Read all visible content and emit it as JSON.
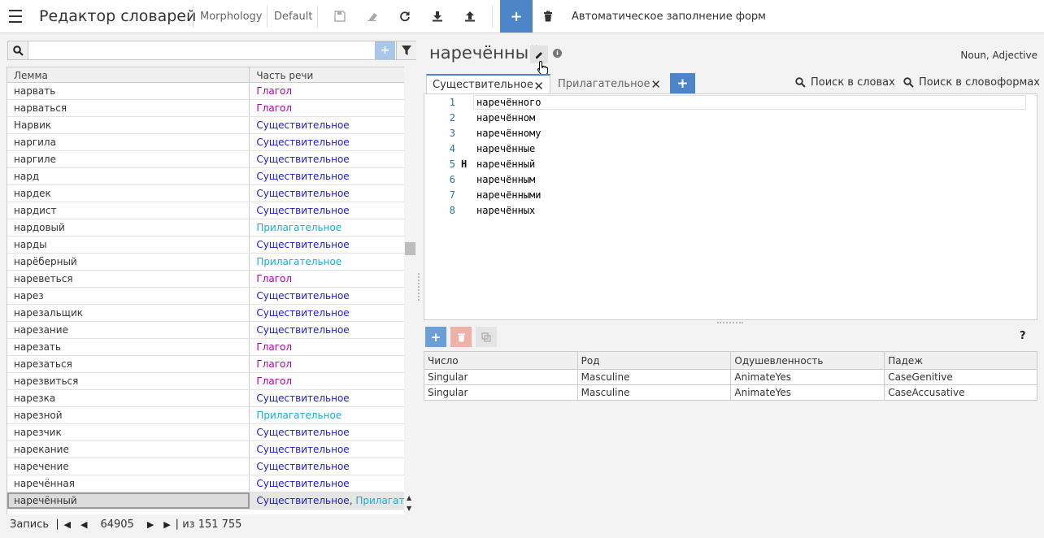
{
  "header": {
    "app_title": "Редактор словарей",
    "module": "Morphology",
    "profile": "Default",
    "autofill_label": "Автоматическое заполнение форм"
  },
  "list": {
    "columns": [
      "Лемма",
      "Часть речи"
    ],
    "rows": [
      {
        "lemma": "нарвать",
        "pos": [
          {
            "text": "Глагол",
            "kind": "verb"
          }
        ]
      },
      {
        "lemma": "нарваться",
        "pos": [
          {
            "text": "Глагол",
            "kind": "verb"
          }
        ]
      },
      {
        "lemma": "Нарвик",
        "pos": [
          {
            "text": "Существительное",
            "kind": "noun"
          }
        ]
      },
      {
        "lemma": "наргила",
        "pos": [
          {
            "text": "Существительное",
            "kind": "noun"
          }
        ]
      },
      {
        "lemma": "наргиле",
        "pos": [
          {
            "text": "Существительное",
            "kind": "noun"
          }
        ]
      },
      {
        "lemma": "нард",
        "pos": [
          {
            "text": "Существительное",
            "kind": "noun"
          }
        ]
      },
      {
        "lemma": "нардек",
        "pos": [
          {
            "text": "Существительное",
            "kind": "noun"
          }
        ]
      },
      {
        "lemma": "нардист",
        "pos": [
          {
            "text": "Существительное",
            "kind": "noun"
          }
        ]
      },
      {
        "lemma": "нардовый",
        "pos": [
          {
            "text": "Прилагательное",
            "kind": "adj"
          }
        ]
      },
      {
        "lemma": "нарды",
        "pos": [
          {
            "text": "Существительное",
            "kind": "noun"
          }
        ]
      },
      {
        "lemma": "нарёберный",
        "pos": [
          {
            "text": "Прилагательное",
            "kind": "adj"
          }
        ]
      },
      {
        "lemma": "нареветься",
        "pos": [
          {
            "text": "Глагол",
            "kind": "verb"
          }
        ]
      },
      {
        "lemma": "нарез",
        "pos": [
          {
            "text": "Существительное",
            "kind": "noun"
          }
        ]
      },
      {
        "lemma": "нарезальщик",
        "pos": [
          {
            "text": "Существительное",
            "kind": "noun"
          }
        ]
      },
      {
        "lemma": "нарезание",
        "pos": [
          {
            "text": "Существительное",
            "kind": "noun"
          }
        ]
      },
      {
        "lemma": "нарезать",
        "pos": [
          {
            "text": "Глагол",
            "kind": "verb"
          }
        ]
      },
      {
        "lemma": "нарезаться",
        "pos": [
          {
            "text": "Глагол",
            "kind": "verb"
          }
        ]
      },
      {
        "lemma": "нарезвиться",
        "pos": [
          {
            "text": "Глагол",
            "kind": "verb"
          }
        ]
      },
      {
        "lemma": "нарезка",
        "pos": [
          {
            "text": "Существительное",
            "kind": "noun"
          }
        ]
      },
      {
        "lemma": "нарезной",
        "pos": [
          {
            "text": "Прилагательное",
            "kind": "adj"
          }
        ]
      },
      {
        "lemma": "нарезчик",
        "pos": [
          {
            "text": "Существительное",
            "kind": "noun"
          }
        ]
      },
      {
        "lemma": "нарекание",
        "pos": [
          {
            "text": "Существительное",
            "kind": "noun"
          }
        ]
      },
      {
        "lemma": "наречение",
        "pos": [
          {
            "text": "Существительное",
            "kind": "noun"
          }
        ]
      },
      {
        "lemma": "наречённая",
        "pos": [
          {
            "text": "Существительное",
            "kind": "noun"
          }
        ]
      },
      {
        "lemma": "наречённый",
        "selected": true,
        "pos": [
          {
            "text": "Существительное",
            "kind": "noun"
          },
          {
            "text": "Прилагательное",
            "kind": "adj"
          }
        ]
      }
    ]
  },
  "pager": {
    "label": "Запись",
    "current": "64905",
    "total": "из 151 755"
  },
  "entry": {
    "word": "наречённый",
    "pos_summary": "Noun, Adjective",
    "tabs": [
      {
        "label": "Существительное",
        "active": true
      },
      {
        "label": "Прилагательное",
        "active": false
      }
    ],
    "search_words_label": "Поиск в словах",
    "search_forms_label": "Поиск в словоформах",
    "forms": [
      {
        "n": "1",
        "marker": "",
        "text": "наречённого"
      },
      {
        "n": "2",
        "marker": "",
        "text": "наречённом"
      },
      {
        "n": "3",
        "marker": "",
        "text": "наречённому"
      },
      {
        "n": "4",
        "marker": "",
        "text": "наречённые"
      },
      {
        "n": "5",
        "marker": "Н",
        "text": "наречённый"
      },
      {
        "n": "6",
        "marker": "",
        "text": "наречённым"
      },
      {
        "n": "7",
        "marker": "",
        "text": "наречёнными"
      },
      {
        "n": "8",
        "marker": "",
        "text": "наречённых"
      }
    ]
  },
  "grammemes": {
    "help": "?",
    "columns": [
      "Число",
      "Род",
      "Одушевленность",
      "Падеж"
    ],
    "rows": [
      [
        "Singular",
        "Masculine",
        "AnimateYes",
        "CaseGenitive"
      ],
      [
        "Singular",
        "Masculine",
        "AnimateYes",
        "CaseAccusative"
      ]
    ]
  }
}
